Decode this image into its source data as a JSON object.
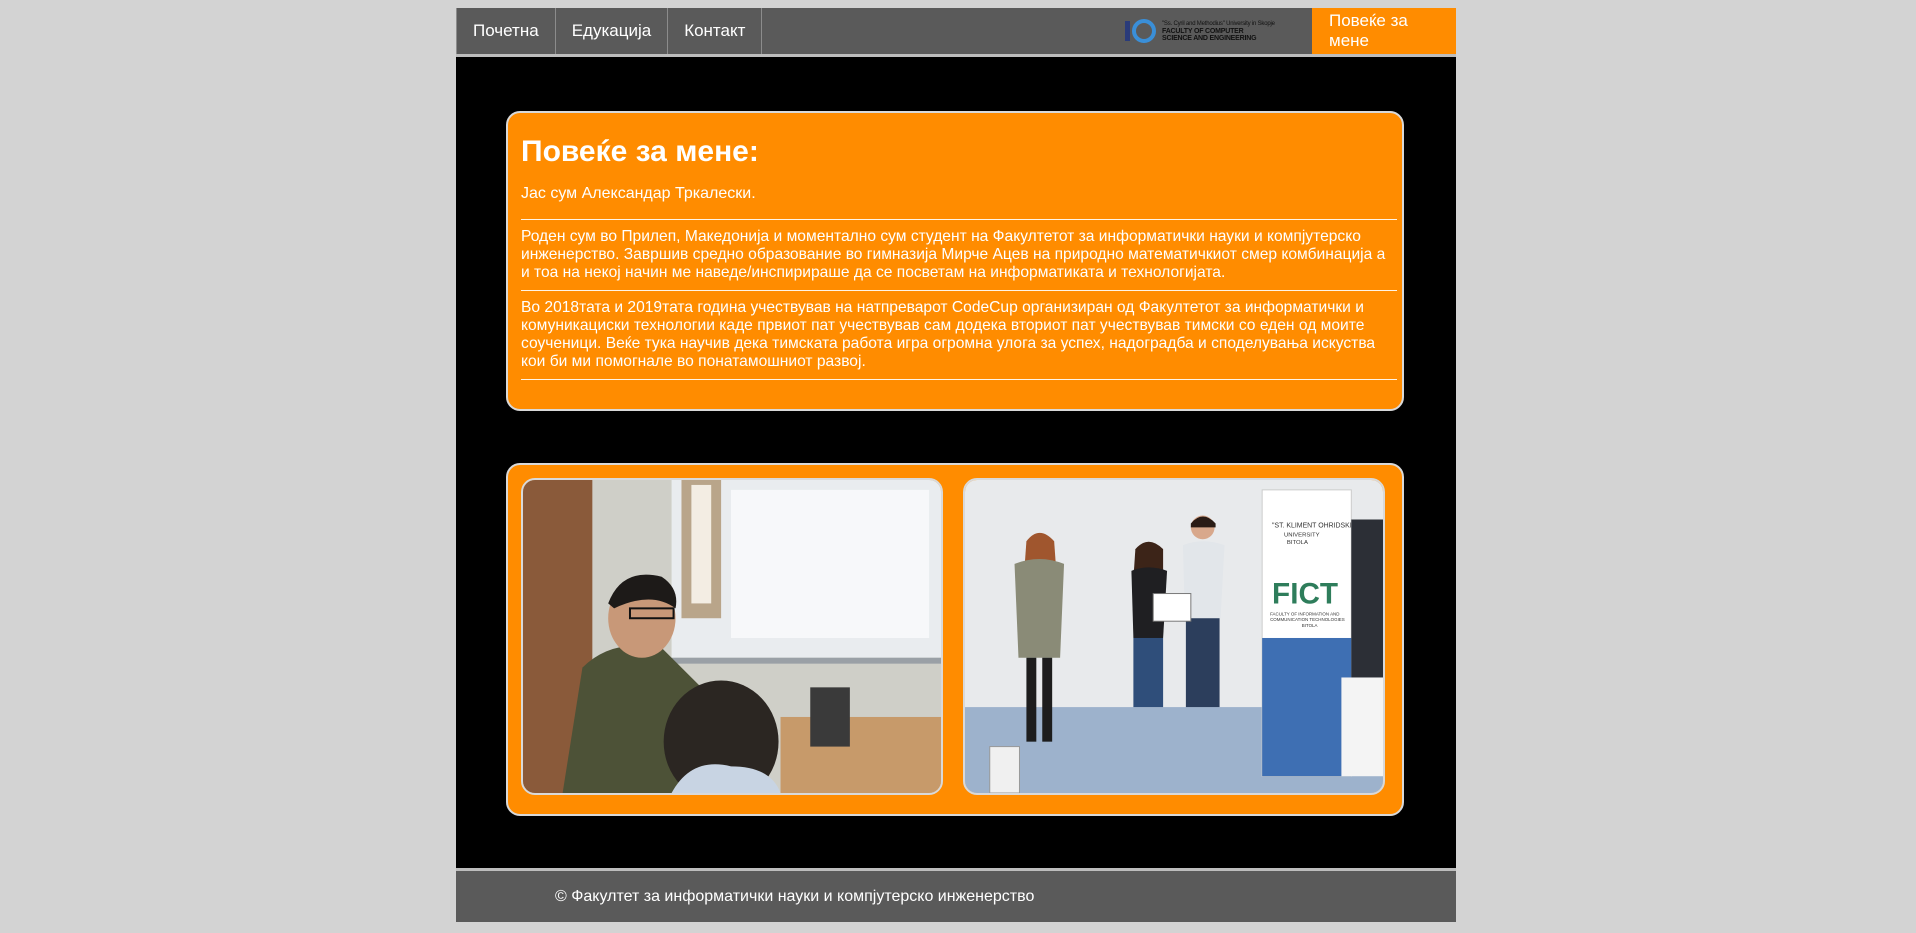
{
  "nav": {
    "items": [
      {
        "label": "Почетна"
      },
      {
        "label": "Едукација"
      },
      {
        "label": "Контакт"
      }
    ],
    "active_label": "Повеќе за мене",
    "logo": {
      "line1": "\"Ss. Cyril and Methodius\" University in Skopje",
      "line2": "FACULTY OF COMPUTER",
      "line3": "SCIENCE AND ENGINEERING"
    }
  },
  "about": {
    "title": "Повеќе за мене:",
    "intro": "Јас сум Александар Тркалески.",
    "paragraphs": [
      "Роден сум во Прилеп, Македонија и моментално сум студент на Факултетот за информатички науки и компјутерско инженерство. Завршив средно образование во гимназија Мирче Ацев на природно математичкиот смер комбинација а и тоа на некој начин ме наведе/инспирираше да се посветам на информатиката и технологијата.",
      "Во 2018тата и 2019тата година учествував на натпреварот CodeCup организиран од Факултетот за информатички и комуникациски технологии каде првиот пат учествував сам додека вториот пат учествував тимски со еден од моите соученици. Веќе тука научив дека тимската работа игра огромна улога за успех, надоградба и споделувања искуства кои би ми помогнале во понатамошниот развој."
    ]
  },
  "photos": {
    "banner": {
      "line1": "\"ST. KLIMENT OHRIDSKI\"",
      "line2": "UNIVERSITY",
      "line3": "BITOLA",
      "brand": "FICT",
      "sub1": "FACULTY OF INFORMATION AND",
      "sub2": "COMMUNICATION TECHNOLOGIES",
      "sub3": "BITOLA"
    }
  },
  "footer": {
    "text": "© Факултет за информатички науки и компјутерско инженерство"
  },
  "colors": {
    "accent": "#ff8c00",
    "nav_bg": "#5a5a5a",
    "page_bg": "#d3d3d3",
    "main_bg": "#000000"
  }
}
